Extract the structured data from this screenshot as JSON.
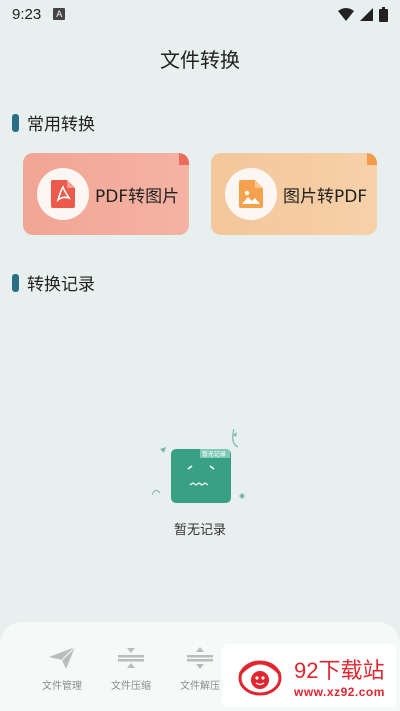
{
  "status_bar": {
    "time": "9:23",
    "notification_icon_letter": "A",
    "icons": [
      "wifi-icon",
      "signal-icon",
      "battery-icon"
    ]
  },
  "header": {
    "title": "文件转换"
  },
  "common_section": {
    "title": "常用转换",
    "cards": [
      {
        "label": "PDF转图片",
        "icon": "pdf-file-icon",
        "accent": "#ec6b5a"
      },
      {
        "label": "图片转PDF",
        "icon": "image-file-icon",
        "accent": "#f29a4c"
      }
    ]
  },
  "records_section": {
    "title": "转换记录",
    "empty_text": "暂无记录",
    "empty_illustration_label": "暂无记录"
  },
  "bottom_nav": {
    "items": [
      {
        "label": "文件管理",
        "icon": "paper-plane-icon"
      },
      {
        "label": "文件压缩",
        "icon": "compress-icon"
      },
      {
        "label": "文件解压",
        "icon": "decompress-icon"
      }
    ]
  },
  "watermark": {
    "title": "92下载站",
    "url": "www.xz92.com"
  },
  "colors": {
    "accent": "#2b6f86",
    "background": "#e7f0ee",
    "folder": "#3aa083"
  }
}
